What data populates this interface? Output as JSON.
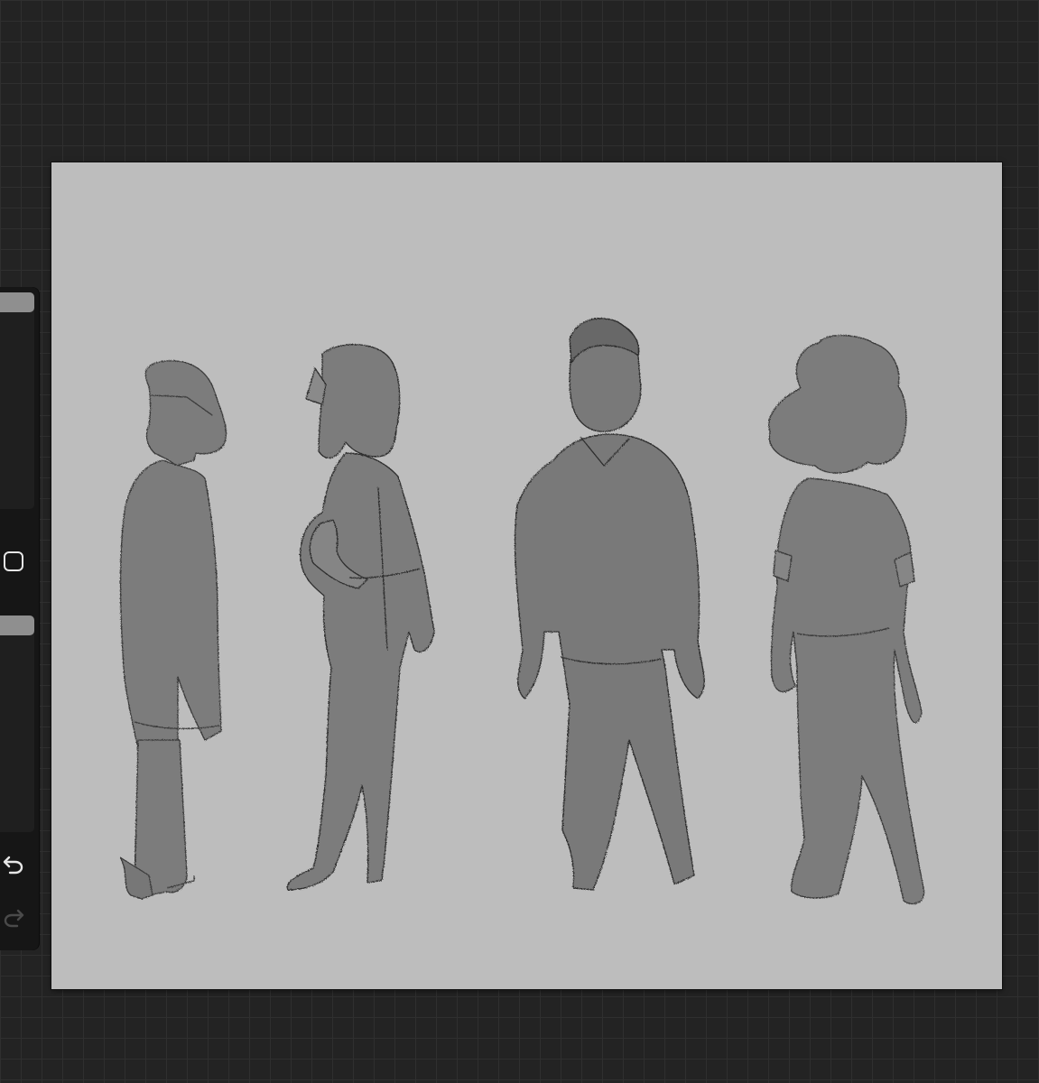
{
  "app": {
    "background_color": "#232323",
    "canvas_color": "#bdbdbd"
  },
  "sidebar": {
    "size_slider": {
      "level": 0.0
    },
    "opacity_slider": {
      "level": 0.0
    },
    "modify_icon": "square-outline-icon",
    "undo_icon": "undo-arrow-icon",
    "redo_icon": "redo-arrow-icon",
    "redo_enabled": false
  },
  "artwork": {
    "figures": [
      {
        "name": "girl-short-hair"
      },
      {
        "name": "girl-hands-on-hip"
      },
      {
        "name": "boy-hoodie"
      },
      {
        "name": "curly-hair-kid"
      }
    ],
    "fill_color": "#7a7a7a",
    "line_color": "#3a3a3a"
  }
}
